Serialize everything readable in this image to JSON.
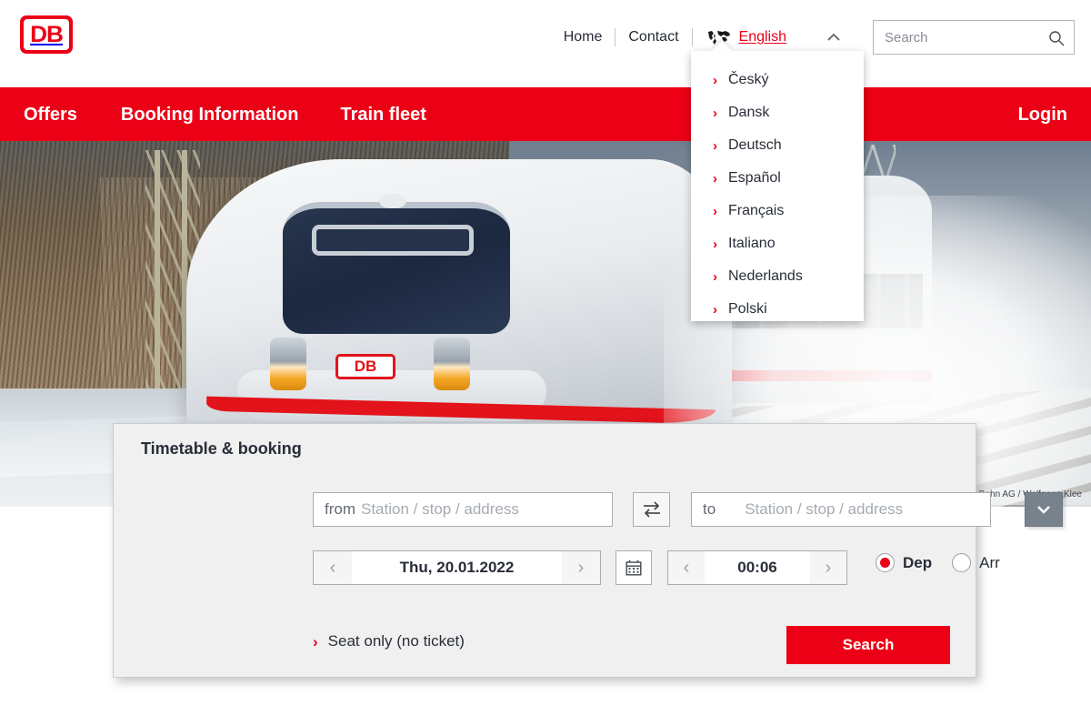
{
  "brand": {
    "logo_text": "DB",
    "accent_red": "#EC0016",
    "dark_text": "#282d37"
  },
  "meta_nav": {
    "home": "Home",
    "contact": "Contact",
    "language_current": "English",
    "world_icon": "world-map-icon",
    "chevron_icon": "chevron-up-icon"
  },
  "search": {
    "placeholder": "Search",
    "value": "",
    "icon": "search-icon"
  },
  "main_nav": {
    "items": [
      {
        "label": "Offers"
      },
      {
        "label": "Booking Information"
      },
      {
        "label": "Train fleet"
      }
    ],
    "login": "Login"
  },
  "language_dropdown": {
    "open": true,
    "items": [
      {
        "label": "Český"
      },
      {
        "label": "Dansk"
      },
      {
        "label": "Deutsch"
      },
      {
        "label": "Español"
      },
      {
        "label": "Français"
      },
      {
        "label": "Italiano"
      },
      {
        "label": "Nederlands"
      },
      {
        "label": "Polski"
      }
    ]
  },
  "hero": {
    "credit": "Deutsche Bahn AG / Wolfgang Klee",
    "train_badge": "DB"
  },
  "booking": {
    "title": "Timetable & booking",
    "from": {
      "label": "from",
      "placeholder": "Station / stop / address",
      "value": ""
    },
    "to": {
      "label": "to",
      "placeholder": "Station / stop / address",
      "value": ""
    },
    "swap_icon": "swap-arrows-icon",
    "more_options_icon": "chevron-down-icon",
    "date": {
      "value": "Thu, 20.01.2022",
      "prev": "‹",
      "next": "›"
    },
    "calendar_icon": "calendar-icon",
    "time": {
      "value": "00:06",
      "prev": "‹",
      "next": "›"
    },
    "dep_arr": {
      "dep_label": "Dep",
      "arr_label": "Arr",
      "selected": "Dep"
    },
    "seat_only_link": "Seat only (no ticket)",
    "search_button": "Search"
  }
}
